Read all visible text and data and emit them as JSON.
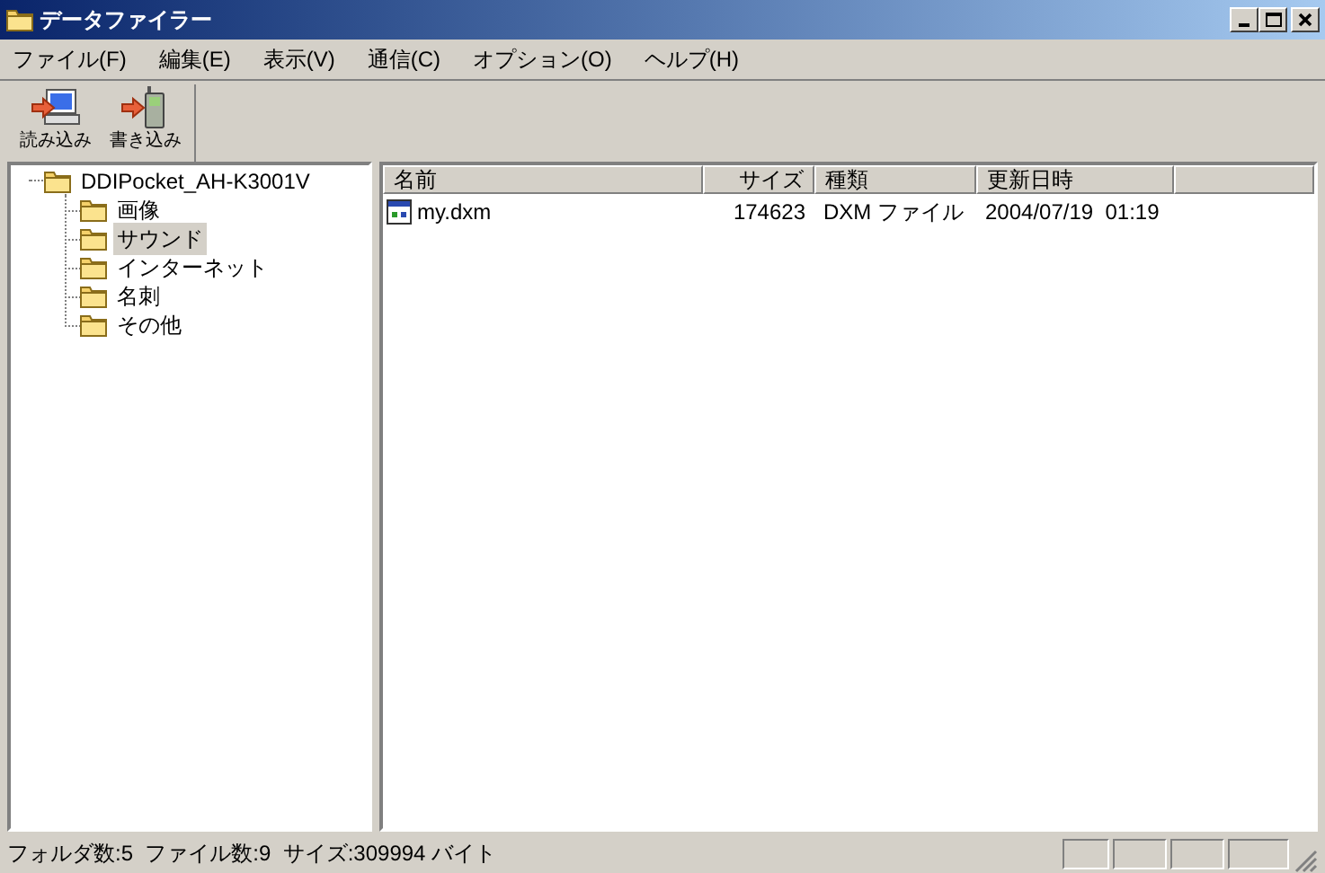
{
  "window": {
    "title": "データファイラー"
  },
  "menu": [
    "ファイル(F)",
    "編集(E)",
    "表示(V)",
    "通信(C)",
    "オプション(O)",
    "ヘルプ(H)"
  ],
  "toolbar": [
    {
      "label": "読み込み",
      "kind": "read"
    },
    {
      "label": "書き込み",
      "kind": "write"
    }
  ],
  "tree": {
    "label": "DDIPocket_AH-K3001V",
    "selected": false,
    "children": [
      {
        "label": "画像",
        "selected": false
      },
      {
        "label": "サウンド",
        "selected": true
      },
      {
        "label": "インターネット",
        "selected": false
      },
      {
        "label": "名刺",
        "selected": false
      },
      {
        "label": "その他",
        "selected": false
      }
    ]
  },
  "list": {
    "columns": [
      {
        "label": "名前"
      },
      {
        "label": "サイズ"
      },
      {
        "label": "種類"
      },
      {
        "label": "更新日時"
      }
    ],
    "rows": [
      {
        "name": "my.dxm",
        "size": "174623",
        "type": "DXM ファイル",
        "modified": "2004/07/19  01:19",
        "selected": false
      }
    ]
  },
  "status_bar": {
    "text": "フォルダ数:5  ファイル数:9  サイズ:309994 バイト"
  }
}
